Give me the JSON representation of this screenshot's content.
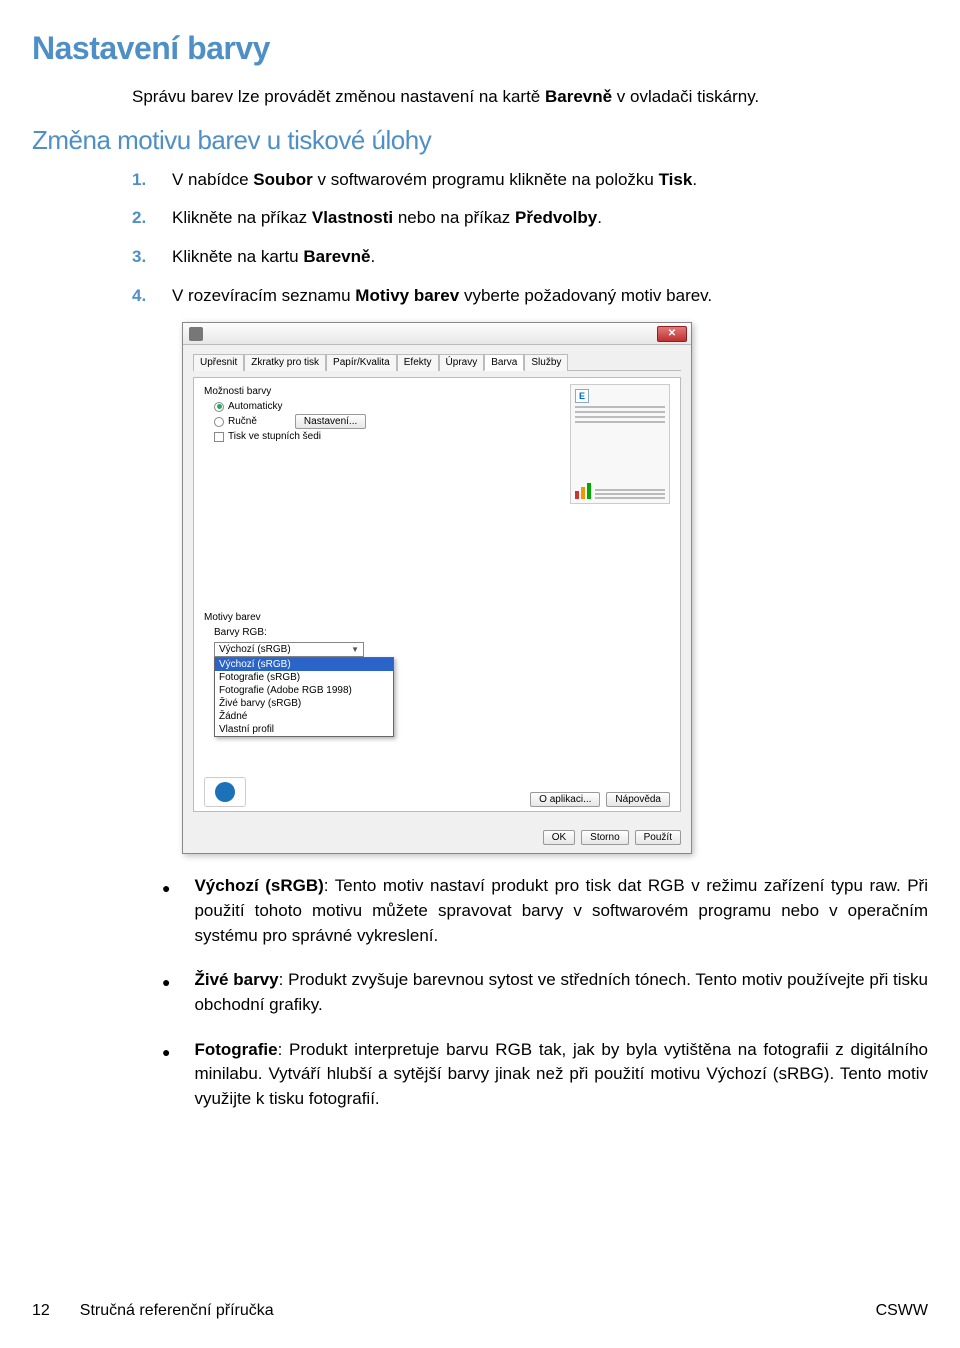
{
  "headings": {
    "h1": "Nastavení barvy",
    "h2": "Změna motivu barev u tiskové úlohy"
  },
  "intro": {
    "pre": "Správu barev lze provádět změnou nastavení na kartě ",
    "b": "Barevně",
    "post": " v ovladači tiskárny."
  },
  "steps": [
    {
      "n": "1.",
      "pre": "V nabídce ",
      "b1": "Soubor",
      "mid": " v softwarovém programu klikněte na položku ",
      "b2": "Tisk",
      "post": "."
    },
    {
      "n": "2.",
      "pre": "Klikněte na příkaz ",
      "b1": "Vlastnosti",
      "mid": " nebo na příkaz ",
      "b2": "Předvolby",
      "post": "."
    },
    {
      "n": "3.",
      "pre": "Klikněte na kartu ",
      "b1": "Barevně",
      "mid": "",
      "b2": "",
      "post": "."
    },
    {
      "n": "4.",
      "pre": "V rozevíracím seznamu ",
      "b1": "Motivy barev",
      "mid": " vyberte požadovaný motiv barev.",
      "b2": "",
      "post": ""
    }
  ],
  "dialog": {
    "tabs": [
      "Upřesnit",
      "Zkratky pro tisk",
      "Papír/Kvalita",
      "Efekty",
      "Úpravy",
      "Barva",
      "Služby"
    ],
    "active_tab": 5,
    "group_label": "Možnosti barvy",
    "radio_auto": "Automaticky",
    "radio_manual": "Ručně",
    "btn_settings": "Nastavení...",
    "check_gray": "Tisk ve stupních šedi",
    "preview_badge": "E",
    "motivy_label": "Motivy barev",
    "rgb_label": "Barvy RGB:",
    "combo_value": "Výchozí (sRGB)",
    "dropdown": [
      "Výchozí (sRGB)",
      "Fotografie (sRGB)",
      "Fotografie (Adobe RGB 1998)",
      "Živé barvy (sRGB)",
      "Žádné",
      "Vlastní profil"
    ],
    "btn_about": "O aplikaci...",
    "btn_help": "Nápověda",
    "btn_ok": "OK",
    "btn_cancel": "Storno",
    "btn_apply": "Použít"
  },
  "bullets": [
    {
      "b": "Výchozí (sRGB)",
      "text": ": Tento motiv nastaví produkt pro tisk dat RGB v režimu zařízení typu raw. Při použití tohoto motivu můžete spravovat barvy v softwarovém programu nebo v operačním systému pro správné vykreslení."
    },
    {
      "b": "Živé barvy",
      "text": ": Produkt zvyšuje barevnou sytost ve středních tónech. Tento motiv používejte při tisku obchodní grafiky."
    },
    {
      "b": "Fotografie",
      "text": ": Produkt interpretuje barvu RGB tak, jak by byla vytištěna na fotografii z digitálního minilabu. Vytváří hlubší a sytější barvy jinak než při použití motivu Výchozí (sRBG). Tento motiv využijte k tisku fotografií."
    }
  ],
  "footer": {
    "page": "12",
    "title": "Stručná referenční příručka",
    "right": "CSWW"
  }
}
